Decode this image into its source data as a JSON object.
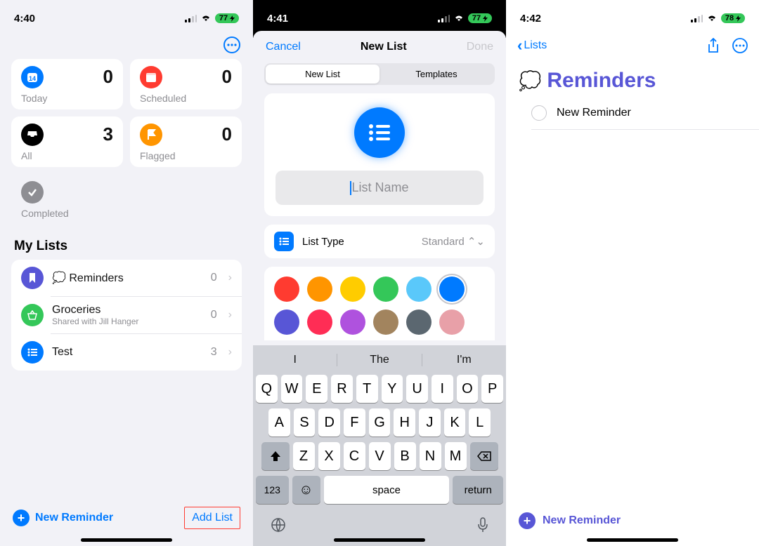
{
  "screen1": {
    "status": {
      "time": "4:40",
      "battery": "77"
    },
    "cards": {
      "today": {
        "label": "Today",
        "count": "0",
        "color": "#007aff"
      },
      "scheduled": {
        "label": "Scheduled",
        "count": "0",
        "color": "#ff3b30"
      },
      "all": {
        "label": "All",
        "count": "3",
        "color": "#000000"
      },
      "flagged": {
        "label": "Flagged",
        "count": "0",
        "color": "#ff9500"
      },
      "completed": {
        "label": "Completed",
        "color": "#8e8e93"
      }
    },
    "section_title": "My Lists",
    "lists": [
      {
        "name": "Reminders",
        "sub": "",
        "count": "0",
        "color": "#5856d6",
        "emoji": "💭"
      },
      {
        "name": "Groceries",
        "sub": "Shared with Jill Hanger",
        "count": "0",
        "color": "#34c759"
      },
      {
        "name": "Test",
        "sub": "",
        "count": "3",
        "color": "#007aff"
      }
    ],
    "bottom": {
      "new_reminder": "New Reminder",
      "add_list": "Add List"
    }
  },
  "screen2": {
    "status": {
      "time": "4:41",
      "battery": "77"
    },
    "nav": {
      "cancel": "Cancel",
      "title": "New List",
      "done": "Done"
    },
    "segmented": {
      "new_list": "New List",
      "templates": "Templates"
    },
    "list_name_placeholder": "List Name",
    "list_type": {
      "label": "List Type",
      "value": "Standard"
    },
    "colors": [
      "#ff3b30",
      "#ff9500",
      "#ffcc00",
      "#34c759",
      "#5ac8fa",
      "#007aff",
      "#5856d6",
      "#ff2d55",
      "#af52de",
      "#a2845e",
      "#5b6770",
      "#e8a0a8"
    ],
    "selected_color_index": 5,
    "keyboard": {
      "suggestions": [
        "I",
        "The",
        "I'm"
      ],
      "row1": [
        "Q",
        "W",
        "E",
        "R",
        "T",
        "Y",
        "U",
        "I",
        "O",
        "P"
      ],
      "row2": [
        "A",
        "S",
        "D",
        "F",
        "G",
        "H",
        "J",
        "K",
        "L"
      ],
      "row3": [
        "Z",
        "X",
        "C",
        "V",
        "B",
        "N",
        "M"
      ],
      "numkey": "123",
      "space": "space",
      "return": "return"
    }
  },
  "screen3": {
    "status": {
      "time": "4:42",
      "battery": "78"
    },
    "back": "Lists",
    "title": "Reminders",
    "emoji": "💭",
    "accent": "#5856d6",
    "reminder_item": "New Reminder",
    "new_reminder": "New Reminder"
  }
}
